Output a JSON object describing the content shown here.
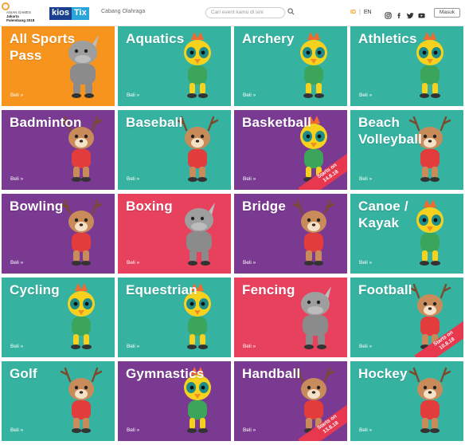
{
  "header": {
    "event_logo": {
      "line1": "ASIAN GAMES",
      "line2": "Jakarta",
      "line3": "Palembang 2018"
    },
    "brand_part1": "kios",
    "brand_part2": "Tix",
    "nav_link": "Cabang Olahraga",
    "search_placeholder": "Cari event kamu di sini",
    "lang_id": "ID",
    "lang_sep": "|",
    "lang_en": "EN",
    "social_icons": [
      "instagram-icon",
      "facebook-icon",
      "twitter-icon",
      "youtube-icon"
    ],
    "login_label": "Masuk"
  },
  "colors": {
    "orange": "#f7941d",
    "teal": "#36b2a1",
    "purple": "#7a3a92",
    "pink": "#e8415e",
    "accent_id": "#f39c12"
  },
  "tiles": [
    {
      "title": "All Sports\nPass",
      "buy": "Beli »",
      "color": "#f7941d",
      "mascot": "rhino"
    },
    {
      "title": "Aquatics",
      "buy": "Beli »",
      "color": "#36b2a1",
      "mascot": "bird"
    },
    {
      "title": "Archery",
      "buy": "Beli »",
      "color": "#36b2a1",
      "mascot": "bird"
    },
    {
      "title": "Athletics",
      "buy": "Beli »",
      "color": "#36b2a1",
      "mascot": "bird"
    },
    {
      "title": "Badminton",
      "buy": "Beli »",
      "color": "#7a3a92",
      "mascot": "deer"
    },
    {
      "title": "Baseball",
      "buy": "Beli »",
      "color": "#36b2a1",
      "mascot": "deer"
    },
    {
      "title": "Basketball",
      "buy": "Beli »",
      "color": "#7a3a92",
      "mascot": "bird",
      "ribbon": "Starts on\n14.8.18"
    },
    {
      "title": "Beach\nVolleyball",
      "buy": "Beli »",
      "color": "#36b2a1",
      "mascot": "deer"
    },
    {
      "title": "Bowling",
      "buy": "Beli »",
      "color": "#7a3a92",
      "mascot": "deer"
    },
    {
      "title": "Boxing",
      "buy": "Beli »",
      "color": "#e8415e",
      "mascot": "rhino"
    },
    {
      "title": "Bridge",
      "buy": "Beli »",
      "color": "#7a3a92",
      "mascot": "deer"
    },
    {
      "title": "Canoe /\nKayak",
      "buy": "Beli »",
      "color": "#36b2a1",
      "mascot": "bird"
    },
    {
      "title": "Cycling",
      "buy": "Beli »",
      "color": "#36b2a1",
      "mascot": "bird"
    },
    {
      "title": "Equestrian",
      "buy": "Beli »",
      "color": "#36b2a1",
      "mascot": "bird"
    },
    {
      "title": "Fencing",
      "buy": "Beli »",
      "color": "#e8415e",
      "mascot": "rhino"
    },
    {
      "title": "Football",
      "buy": "Beli »",
      "color": "#36b2a1",
      "mascot": "deer",
      "ribbon": "Starts on\n10.8.18"
    },
    {
      "title": "Golf",
      "buy": "Beli »",
      "color": "#36b2a1",
      "mascot": "deer"
    },
    {
      "title": "Gymnastics",
      "buy": "Beli »",
      "color": "#7a3a92",
      "mascot": "bird"
    },
    {
      "title": "Handball",
      "buy": "Beli »",
      "color": "#7a3a92",
      "mascot": "deer",
      "ribbon": "Starts on\n13.8.18"
    },
    {
      "title": "Hockey",
      "buy": "Beli »",
      "color": "#36b2a1",
      "mascot": "deer"
    }
  ]
}
